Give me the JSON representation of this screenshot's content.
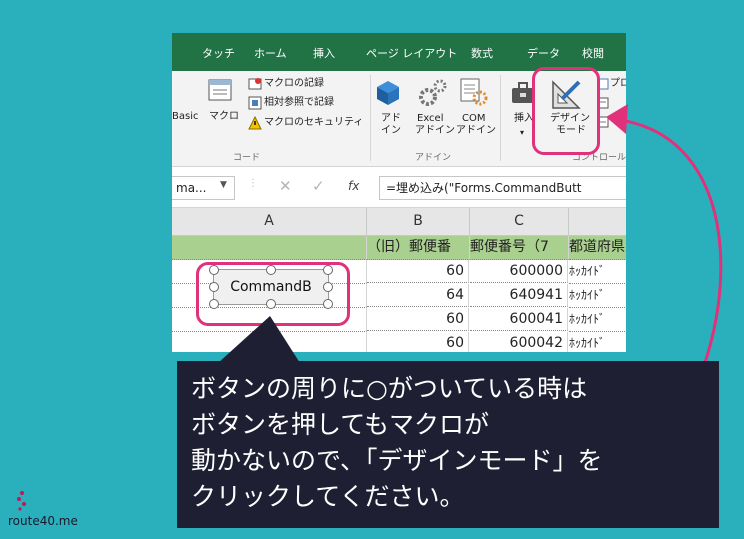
{
  "ribbon": {
    "tabs": [
      "タッチ",
      "ホーム",
      "挿入",
      "ページ レイアウト",
      "数式",
      "データ",
      "校閲"
    ],
    "basic_label": "Basic",
    "macro_label": "マクロ",
    "record_macro": "マクロの記録",
    "relative_ref": "相対参照で記録",
    "macro_security": "マクロのセキュリティ",
    "code_group": "コード",
    "addin_1a": "アド",
    "addin_1b": "イン",
    "excel_addin_1": "Excel",
    "excel_addin_2": "アドイン",
    "com_addin_1": "COM",
    "com_addin_2": "アドイン",
    "addin_group": "アドイン",
    "insert_label": "挿入",
    "design_mode_1": "デザイン",
    "design_mode_2": "モード",
    "prop_label": "プロ",
    "control_group": "コントロール"
  },
  "formula_bar": {
    "name_box": "ma...",
    "fx": "fx",
    "formula": "=埋め込み(\"Forms.CommandButt"
  },
  "sheet": {
    "col_a": "A",
    "col_b": "B",
    "col_c": "C",
    "header_b": "（旧）郵便番",
    "header_c": "郵便番号（7",
    "header_d": "都道府県",
    "rows": [
      {
        "b": "60",
        "c": "600000",
        "d": "ﾎｯｶｲﾄﾞ"
      },
      {
        "b": "64",
        "c": "640941",
        "d": "ﾎｯｶｲﾄﾞ"
      },
      {
        "b": "60",
        "c": "600041",
        "d": "ﾎｯｶｲﾄﾞ"
      },
      {
        "b": "60",
        "c": "600042",
        "d": "ﾎｯｶｲﾄﾞ"
      }
    ],
    "command_button": "CommandB"
  },
  "callout": {
    "lines": [
      "ボタンの周りに○がついている時は",
      "ボタンを押してもマクロが",
      "動かないので、「デザインモード」を",
      "クリックしてください。"
    ]
  },
  "logo": {
    "text": "route40.me"
  },
  "colors": {
    "accent": "#e0317a",
    "excel_green": "#217346",
    "background": "#2ab0bd",
    "callout_bg": "#1e1f33"
  }
}
